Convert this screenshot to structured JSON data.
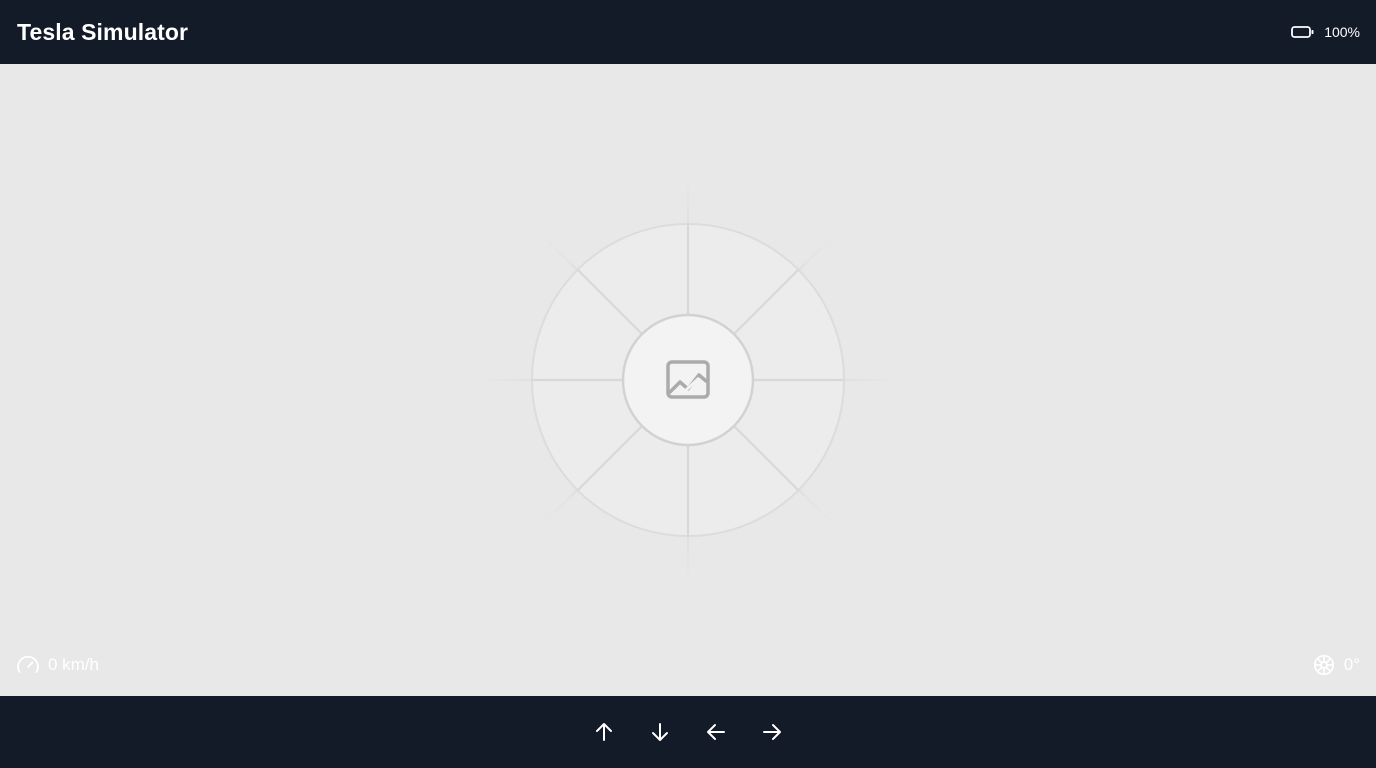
{
  "header": {
    "title": "Tesla Simulator",
    "battery_icon": "battery-icon",
    "battery_level": "100%"
  },
  "stage": {
    "placeholder_icon": "image-icon"
  },
  "status": {
    "speed_icon": "gauge-icon",
    "speed": "0 km/h",
    "steering_icon": "steering-wheel-icon",
    "steering_angle": "0°"
  },
  "controls": [
    {
      "name": "up",
      "icon": "arrow-up-icon"
    },
    {
      "name": "down",
      "icon": "arrow-down-icon"
    },
    {
      "name": "left",
      "icon": "arrow-left-icon"
    },
    {
      "name": "right",
      "icon": "arrow-right-icon"
    }
  ],
  "colors": {
    "bar_background": "#131a28",
    "stage_background": "#e8e8e8",
    "text": "#ffffff"
  }
}
